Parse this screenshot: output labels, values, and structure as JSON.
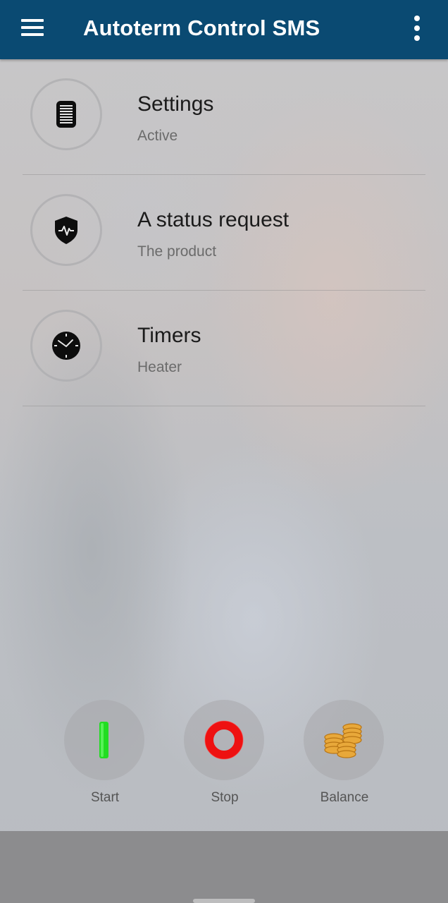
{
  "app": {
    "title": "Autoterm Control SMS",
    "bar_color": "#0a4a72"
  },
  "toolbar": {
    "menu_icon": "hamburger-menu-icon",
    "overflow_icon": "vertical-dots-icon"
  },
  "menu_items": [
    {
      "title": "Settings",
      "subtitle": "Active",
      "icon": "sim-card-icon"
    },
    {
      "title": "A status request",
      "subtitle": "The product",
      "icon": "shield-pulse-icon"
    },
    {
      "title": "Timers",
      "subtitle": "Heater",
      "icon": "clock-icon"
    }
  ],
  "actions": [
    {
      "label": "Start",
      "icon": "start-bar-icon",
      "color": "#22dd22"
    },
    {
      "label": "Stop",
      "icon": "stop-ring-icon",
      "color": "#ee1111"
    },
    {
      "label": "Balance",
      "icon": "coins-icon",
      "color": "#e8a83a"
    }
  ]
}
